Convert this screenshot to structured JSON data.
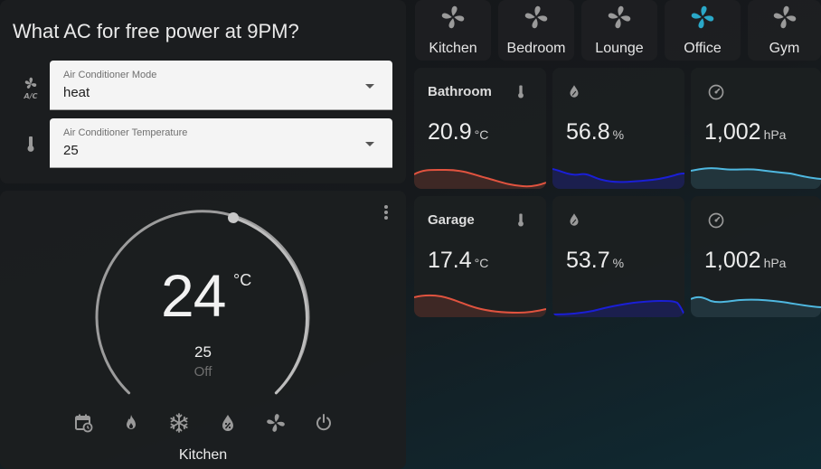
{
  "ac_card": {
    "title": "What AC for free power at 9PM?",
    "mode_select": {
      "label": "Air Conditioner Mode",
      "value": "heat"
    },
    "temp_select": {
      "label": "Air Conditioner Temperature",
      "value": "25"
    }
  },
  "thermostat": {
    "current_temp": "24",
    "unit": "°C",
    "target_temp": "25",
    "state": "Off",
    "name": "Kitchen",
    "modes": [
      "schedule-icon",
      "fire-icon",
      "snowflake-icon",
      "water-percent-icon",
      "fan-icon",
      "power-icon"
    ]
  },
  "rooms": [
    {
      "name": "Kitchen",
      "active": false
    },
    {
      "name": "Bedroom",
      "active": false
    },
    {
      "name": "Lounge",
      "active": false
    },
    {
      "name": "Office",
      "active": true
    },
    {
      "name": "Gym",
      "active": false
    }
  ],
  "sensors": {
    "bathroom": {
      "title": "Bathroom",
      "temperature": {
        "value": "20.9",
        "unit": "°C",
        "color": "#e0533f"
      },
      "humidity": {
        "value": "56.8",
        "unit": "%",
        "color": "#1a1fd6"
      },
      "pressure": {
        "value": "1,002",
        "unit": "hPa",
        "color": "#4fb8e0"
      }
    },
    "garage": {
      "title": "Garage",
      "temperature": {
        "value": "17.4",
        "unit": "°C",
        "color": "#e0533f"
      },
      "humidity": {
        "value": "53.7",
        "unit": "%",
        "color": "#1a1fd6"
      },
      "pressure": {
        "value": "1,002",
        "unit": "hPa",
        "color": "#4fb8e0"
      }
    }
  },
  "colors": {
    "active_icon": "#2aa8c8",
    "inactive_icon": "#9a9a9a",
    "select_bg": "#f4f4f4"
  }
}
